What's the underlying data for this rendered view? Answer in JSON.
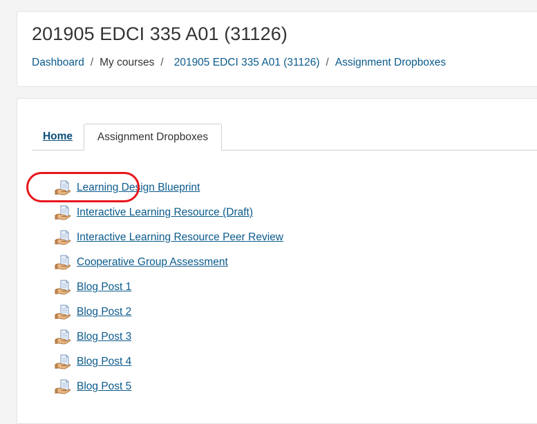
{
  "header": {
    "title": "201905 EDCI 335 A01 (31126)",
    "breadcrumb": [
      {
        "label": "Dashboard",
        "link": true
      },
      {
        "label": "My courses",
        "link": false
      },
      {
        "label": "201905 EDCI 335 A01 (31126)",
        "link": true
      },
      {
        "label": "Assignment Dropboxes",
        "link": true
      }
    ],
    "separator": "/"
  },
  "tabs": [
    {
      "label": "Home",
      "active": false
    },
    {
      "label": "Assignment Dropboxes",
      "active": true
    }
  ],
  "activities": [
    {
      "label": "Learning Design Blueprint",
      "icon": "assignment-icon"
    },
    {
      "label": "Interactive Learning Resource (Draft)",
      "icon": "assignment-icon"
    },
    {
      "label": "Interactive Learning Resource Peer Review",
      "icon": "assignment-icon"
    },
    {
      "label": "Cooperative Group Assessment",
      "icon": "assignment-icon"
    },
    {
      "label": "Blog Post 1",
      "icon": "assignment-icon",
      "highlighted": true
    },
    {
      "label": "Blog Post 2",
      "icon": "assignment-icon"
    },
    {
      "label": "Blog Post 3",
      "icon": "assignment-icon"
    },
    {
      "label": "Blog Post 4",
      "icon": "assignment-icon"
    },
    {
      "label": "Blog Post 5",
      "icon": "assignment-icon"
    }
  ],
  "colors": {
    "link": "#0a5a8c",
    "highlight_ring": "#e8151b",
    "page_background": "#f4f4f4"
  }
}
